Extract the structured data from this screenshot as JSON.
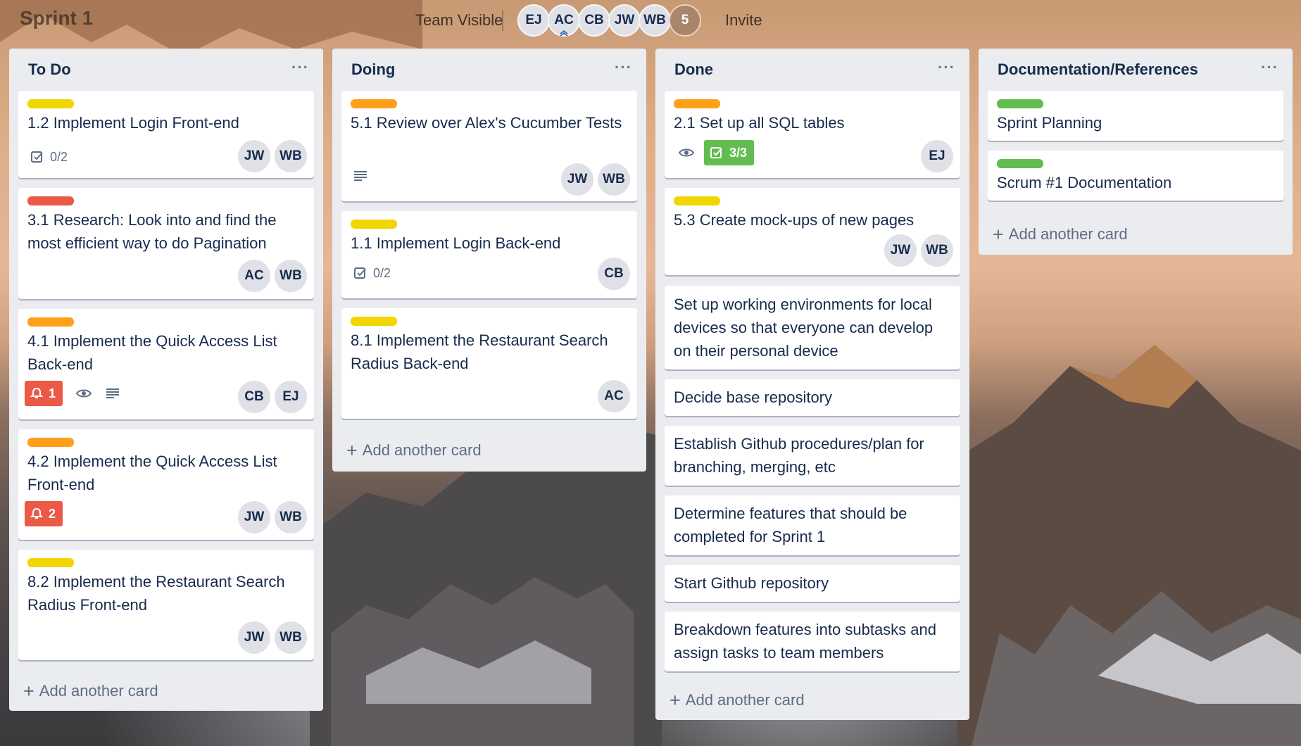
{
  "header": {
    "board_title": "Sprint 1",
    "visibility": "Team Visible",
    "members": [
      "EJ",
      "AC",
      "CB",
      "JW",
      "WB"
    ],
    "extra_members": "5",
    "invite_label": "Invite"
  },
  "colors": {
    "yellow": "#f2d600",
    "orange": "#ff9f1a",
    "red": "#eb5a46",
    "green": "#61bd4f"
  },
  "lists": [
    {
      "title": "To Do",
      "add_card_label": "Add another card",
      "cards": [
        {
          "label": "yellow",
          "title": "1.2 Implement Login Front-end",
          "checklist": "0/2",
          "members": [
            "JW",
            "WB"
          ]
        },
        {
          "label": "red",
          "title": "3.1 Research: Look into and find the most efficient way to do Pagination",
          "members": [
            "AC",
            "WB"
          ]
        },
        {
          "label": "orange",
          "title": "4.1 Implement the Quick Access List Back-end",
          "notifications": "1",
          "watching": true,
          "description": true,
          "members": [
            "CB",
            "EJ"
          ]
        },
        {
          "label": "orange",
          "title": "4.2 Implement the Quick Access List Front-end",
          "notifications": "2",
          "members": [
            "JW",
            "WB"
          ]
        },
        {
          "label": "yellow",
          "title": "8.2 Implement the Restaurant Search Radius Front-end",
          "members": [
            "JW",
            "WB"
          ]
        }
      ]
    },
    {
      "title": "Doing",
      "add_card_label": "Add another card",
      "cards": [
        {
          "label": "orange",
          "title": "5.1 Review over Alex's Cucumber Tests",
          "description": true,
          "members": [
            "JW",
            "WB"
          ]
        },
        {
          "label": "yellow",
          "title": "1.1 Implement Login Back-end",
          "checklist": "0/2",
          "members": [
            "CB"
          ]
        },
        {
          "label": "yellow",
          "title": "8.1 Implement the Restaurant Search Radius Back-end",
          "members": [
            "AC"
          ]
        }
      ]
    },
    {
      "title": "Done",
      "add_card_label": "Add another card",
      "cards": [
        {
          "label": "orange",
          "title": "2.1 Set up all SQL tables",
          "watching": true,
          "checklist_complete": "3/3",
          "members": [
            "EJ"
          ]
        },
        {
          "label": "yellow",
          "title": "5.3 Create mock-ups of new pages",
          "members": [
            "JW",
            "WB"
          ]
        },
        {
          "title": "Set up working environments for local devices so that everyone can develop on their personal device"
        },
        {
          "title": "Decide base repository"
        },
        {
          "title": "Establish Github procedures/plan for branching, merging, etc"
        },
        {
          "title": "Determine features that should be completed for Sprint 1"
        },
        {
          "title": "Start Github repository"
        },
        {
          "title": "Breakdown features into subtasks and assign tasks to team members"
        }
      ]
    },
    {
      "title": "Documentation/References",
      "add_card_label": "Add another card",
      "cards": [
        {
          "label": "green",
          "title": "Sprint Planning"
        },
        {
          "label": "green",
          "title": "Scrum #1 Documentation"
        }
      ]
    }
  ]
}
